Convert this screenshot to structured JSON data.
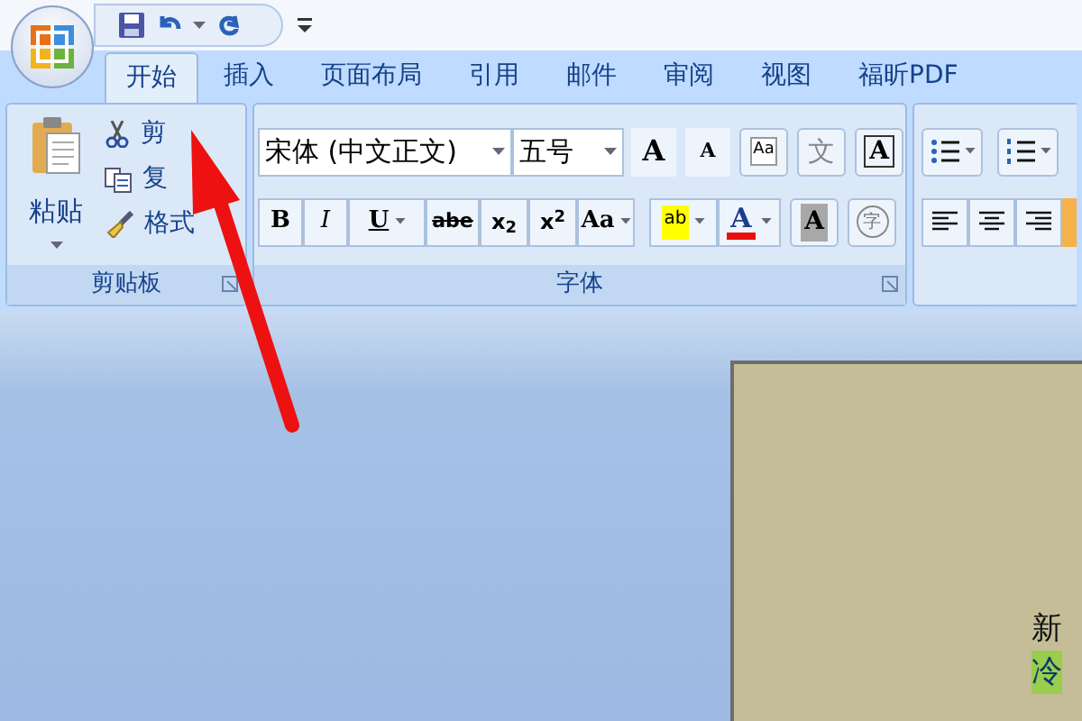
{
  "tabs": [
    {
      "label": "开始",
      "selected": true
    },
    {
      "label": "插入",
      "selected": false
    },
    {
      "label": "页面布局",
      "selected": false
    },
    {
      "label": "引用",
      "selected": false
    },
    {
      "label": "邮件",
      "selected": false
    },
    {
      "label": "审阅",
      "selected": false
    },
    {
      "label": "视图",
      "selected": false
    },
    {
      "label": "福昕PDF",
      "selected": false
    }
  ],
  "clipboard": {
    "paste": "粘贴",
    "items": [
      {
        "kind": "cut",
        "label": "剪"
      },
      {
        "kind": "copy",
        "label": "复"
      },
      {
        "kind": "painter",
        "label": "格式"
      }
    ],
    "label": "剪贴板"
  },
  "font": {
    "font_name": "宋体 (中文正文)",
    "font_size": "五号",
    "label": "字体",
    "row1": [
      {
        "kind": "grow",
        "text": "A"
      },
      {
        "kind": "shrink",
        "text": "A"
      },
      {
        "kind": "clear",
        "text": "Aa"
      },
      {
        "kind": "phonetic",
        "text": "文"
      },
      {
        "kind": "border",
        "text": "A"
      }
    ],
    "row2": [
      {
        "kind": "bold",
        "text": "B"
      },
      {
        "kind": "italic",
        "text": "I"
      },
      {
        "kind": "underline",
        "text": "U"
      },
      {
        "kind": "strike",
        "text": "abe"
      },
      {
        "kind": "sub",
        "text": "x$_{2}$"
      },
      {
        "kind": "sup",
        "text": "x$^{2}$"
      },
      {
        "kind": "case",
        "text": "Aa"
      },
      {
        "kind": "highlight",
        "text": "ab"
      },
      {
        "kind": "color",
        "text": "A"
      },
      {
        "kind": "shade",
        "text": "A"
      },
      {
        "kind": "enclose",
        "text": "字"
      }
    ]
  },
  "document": {
    "lines": [
      {
        "text": "新",
        "highlighted": false
      },
      {
        "text": "冷",
        "highlighted": true
      }
    ]
  }
}
